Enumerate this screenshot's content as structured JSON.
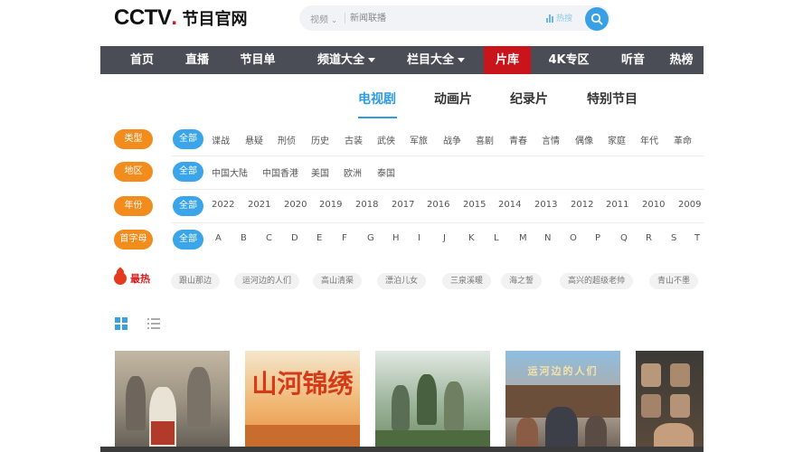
{
  "header": {
    "logo_text": "CCTV",
    "logo_dot": ".",
    "logo_sub": "节目官网",
    "search_type": "视频",
    "search_placeholder": "新闻联播",
    "hot_search_label": "热搜",
    "accent_color": "#3aa0e5"
  },
  "nav": {
    "items": [
      {
        "label": "首页",
        "dropdown": false,
        "active": false
      },
      {
        "label": "直播",
        "dropdown": false,
        "active": false
      },
      {
        "label": "节目单",
        "dropdown": false,
        "active": false
      },
      {
        "label": "频道大全",
        "dropdown": true,
        "active": false
      },
      {
        "label": "栏目大全",
        "dropdown": true,
        "active": false
      },
      {
        "label": "片库",
        "dropdown": false,
        "active": true
      },
      {
        "label": "4K专区",
        "dropdown": false,
        "active": false
      },
      {
        "label": "听音",
        "dropdown": false,
        "active": false
      },
      {
        "label": "热榜",
        "dropdown": false,
        "active": false
      }
    ],
    "active_color": "#c9141c"
  },
  "category_tabs": [
    {
      "label": "电视剧",
      "active": true
    },
    {
      "label": "动画片",
      "active": false
    },
    {
      "label": "纪录片",
      "active": false
    },
    {
      "label": "特别节目",
      "active": false
    }
  ],
  "filters": {
    "type": {
      "label": "类型",
      "options": [
        "全部",
        "谍战",
        "悬疑",
        "刑侦",
        "历史",
        "古装",
        "武侠",
        "军旅",
        "战争",
        "喜剧",
        "青春",
        "言情",
        "偶像",
        "家庭",
        "年代",
        "革命"
      ]
    },
    "region": {
      "label": "地区",
      "options": [
        "全部",
        "中国大陆",
        "中国香港",
        "美国",
        "欧洲",
        "泰国"
      ]
    },
    "year": {
      "label": "年份",
      "options": [
        "全部",
        "2022",
        "2021",
        "2020",
        "2019",
        "2018",
        "2017",
        "2016",
        "2015",
        "2014",
        "2013",
        "2012",
        "2011",
        "2010",
        "2009"
      ]
    },
    "letter": {
      "label": "首字母",
      "options": [
        "全部",
        "A",
        "B",
        "C",
        "D",
        "E",
        "F",
        "G",
        "H",
        "I",
        "J",
        "K",
        "L",
        "M",
        "N",
        "O",
        "P",
        "Q",
        "R",
        "S",
        "T"
      ]
    },
    "label_color": "#f28c1c",
    "active_color": "#3aa5e8"
  },
  "hot": {
    "label": "最热",
    "tags": [
      "跟山那边",
      "运河边的人们",
      "高山清渠",
      "漂泊儿女",
      "三泉溪暖",
      "海之誓",
      "高兴的超级老帅",
      "青山不墨"
    ]
  },
  "view_toggle": {
    "grid_icon": "grid-icon",
    "list_icon": "list-icon"
  },
  "posters": [
    {
      "title": ""
    },
    {
      "title": "山河锦绣"
    },
    {
      "title": ""
    },
    {
      "title": "运河边的人们"
    },
    {
      "title": ""
    }
  ]
}
